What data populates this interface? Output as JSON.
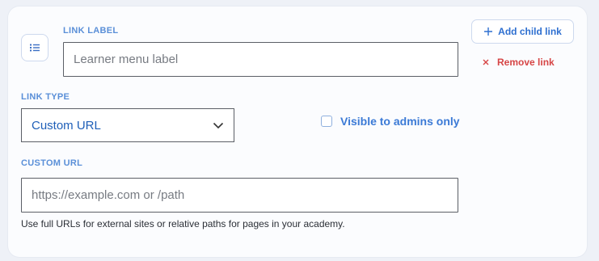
{
  "link": {
    "label_field": {
      "label": "LINK LABEL",
      "value": "",
      "placeholder": "Learner menu label"
    },
    "type_field": {
      "label": "LINK TYPE",
      "selected": "Custom URL"
    },
    "visibility": {
      "label": "Visible to admins only",
      "checked": false
    },
    "url_field": {
      "label": "CUSTOM URL",
      "value": "",
      "placeholder": "https://example.com or /path",
      "help": "Use full URLs for external sites or relative paths for pages in your academy."
    }
  },
  "actions": {
    "add_child": "Add child link",
    "remove": "Remove link"
  },
  "icons": {
    "handle": "list-icon",
    "add": "plus-icon",
    "remove": "close-icon",
    "dropdown": "chevron-down-icon"
  },
  "colors": {
    "accent": "#2e6fd0",
    "label": "#5a8fd8",
    "danger": "#d64545"
  }
}
